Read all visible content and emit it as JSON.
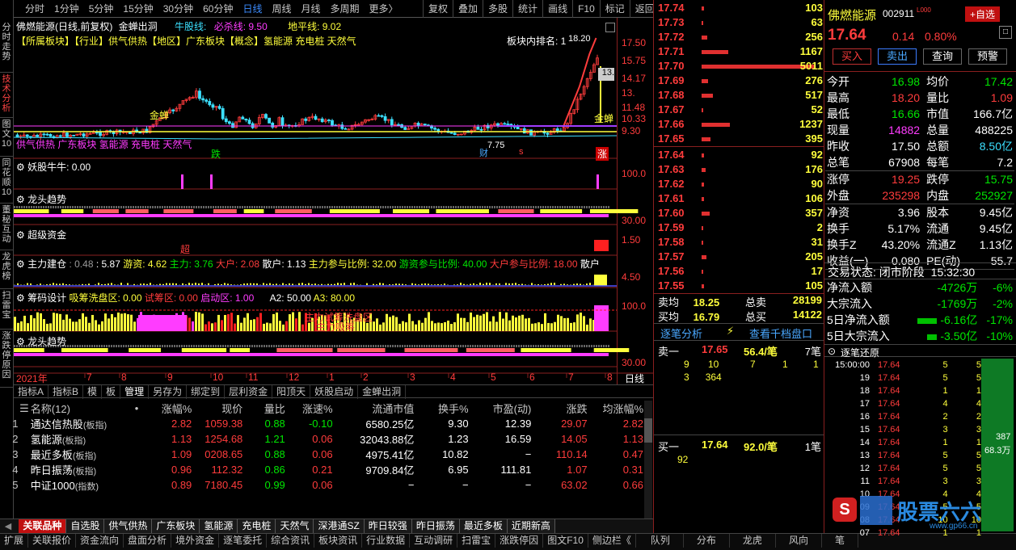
{
  "vtabs": [
    "分时走势",
    "技术分析",
    "图文10",
    "同花顺10",
    "董秘互动",
    "龙虎榜",
    "扫雷宝",
    "涨跌停原因"
  ],
  "toolbar": {
    "periods": [
      "分时",
      "1分钟",
      "5分钟",
      "15分钟",
      "30分钟",
      "60分钟",
      "日线",
      "周线",
      "月线",
      "多周期",
      "更多〉"
    ],
    "active": "日线",
    "right": [
      "复权",
      "叠加",
      "多股",
      "统计",
      "画线",
      "F10",
      "标记",
      "返回"
    ]
  },
  "main": {
    "title": "佛燃能源(日线,前复权)",
    "indicator": "金蝉出洞",
    "nl_label": "牛股线:",
    "bs_label": "必杀线: 9.50",
    "dp_label": "地平线: 9.02",
    "tags": "【所属板块】【行业】供气供热【地区】广东板块【概念】氢能源 充电桩 天然气",
    "rank_label": "板块内排名:  1",
    "peak": "18.20",
    "ticks": [
      "17.50",
      "15.75",
      "14.17",
      "13.",
      "11.48",
      "10.33",
      "9.30"
    ],
    "overlay": "供气供热 广东板块 氢能源 充电桩 天然气",
    "marks": {
      "jinchan1": "金蝉",
      "jinchan2": "金蝉",
      "die": "跌",
      "cai": "财",
      "low": "7.75",
      "s": "s",
      "zhang": "涨"
    }
  },
  "panels": [
    {
      "name": "妖股牛牛",
      "text": "妖股牛牛: 0.00",
      "tick": "100.0"
    },
    {
      "name": "龙头趋势",
      "text": "龙头趋势",
      "tick": "30.00"
    },
    {
      "name": "超级资金",
      "text": "超级资金",
      "tick": "1.50",
      "mark": "超"
    },
    {
      "name": "主力建仓",
      "values": [
        {
          "t": "主力建仓",
          "c": "wht"
        },
        {
          "t": ": 0.48",
          "c": "gry"
        },
        {
          "t": ": 5.87",
          "c": "wht"
        },
        {
          "t": "游资: 4.62",
          "c": "yel"
        },
        {
          "t": "主力: 3.76",
          "c": "grn"
        },
        {
          "t": "大户: 2.08",
          "c": "red"
        },
        {
          "t": "散户: 1.13",
          "c": "wht"
        },
        {
          "t": "主力参与比例: 32.00",
          "c": "yel"
        },
        {
          "t": "游资参与比例: 40.00",
          "c": "grn"
        },
        {
          "t": "大户参与比例: 18.00",
          "c": "red"
        },
        {
          "t": "散户",
          "c": "wht"
        }
      ],
      "tick": "4.50"
    },
    {
      "name": "筹码设计",
      "values": [
        {
          "t": "筹码设计",
          "c": "wht"
        },
        {
          "t": "吸筹洗盘区: 0.00",
          "c": "yel"
        },
        {
          "t": "试筹区: 0.00",
          "c": "red"
        },
        {
          "t": "启动区: 1.00",
          "c": "mag"
        },
        {
          "t": "A2: 50.00",
          "c": "wht"
        },
        {
          "t": "A3: 80.00",
          "c": "yel"
        }
      ],
      "tick": "100.0",
      "tick2": "0.0",
      "overlay1": "主力试筹洗盘区",
      "overlay2": "主力吸筹"
    },
    {
      "name": "龙头趋势2",
      "text": "龙头趋势",
      "tick": "30.00"
    }
  ],
  "xaxis": {
    "labels": [
      "2021年",
      "7",
      "8",
      "9",
      "10",
      "11",
      "12",
      "1",
      "2",
      "3",
      "4",
      "5",
      "6",
      "7",
      "8"
    ],
    "right": "日线"
  },
  "subtabs": [
    "指标A",
    "指标B",
    "模",
    "板",
    "管理",
    "另存为",
    "绑定到",
    "层利资金",
    "阳顶天",
    "妖股启动",
    "金蝉出洞"
  ],
  "blocks": {
    "headers": [
      "名称(12)",
      "•",
      "涨幅%",
      "现价",
      "量比",
      "涨速%",
      "流通市值",
      "换手%",
      "市盈(动)",
      "涨跌",
      "均涨幅%"
    ],
    "rows": [
      [
        "1",
        "通达信热股",
        "(板指)",
        "2.82",
        "1059.38",
        "0.88",
        "-0.10",
        "6580.25亿",
        "9.30",
        "12.39",
        "29.07",
        "2.82"
      ],
      [
        "2",
        "氢能源",
        "(板指)",
        "1.13",
        "1254.68",
        "1.21",
        "0.06",
        "32043.88亿",
        "1.23",
        "16.59",
        "14.05",
        "1.13"
      ],
      [
        "3",
        "最近多板",
        "(板指)",
        "1.09",
        "0208.65",
        "0.88",
        "0.06",
        "4975.41亿",
        "10.82",
        "−",
        "110.14",
        "0.47"
      ],
      [
        "4",
        "昨日振荡",
        "(板指)",
        "0.96",
        "112.32",
        "0.86",
        "0.21",
        "9709.84亿",
        "6.95",
        "111.81",
        "1.07",
        "0.31"
      ],
      [
        "5",
        "中证1000",
        "(指数)",
        "0.89",
        "7180.45",
        "0.99",
        "0.06",
        "−",
        "−",
        "−",
        "63.02",
        "0.66"
      ]
    ]
  },
  "bottom_tabs": [
    "关联品种",
    "自选股",
    "供气供热",
    "广东板块",
    "氢能源",
    "充电桩",
    "天然气",
    "深港通SZ",
    "昨日较强",
    "昨日振荡",
    "最近多板",
    "近期新高"
  ],
  "status_bar": [
    "扩展",
    "关联报价",
    "资金流向",
    "盘面分析",
    "境外资金",
    "逐笔委托",
    "综合资讯",
    "板块资讯",
    "行业数据",
    "互动调研",
    "扫雷宝",
    "涨跌停因",
    "图文F10",
    "侧边栏《",
    "队列",
    "分布",
    "龙虎",
    "风向",
    "笔"
  ],
  "asks": [
    [
      "17.74",
      "103"
    ],
    [
      "17.73",
      "63"
    ],
    [
      "17.72",
      "256"
    ],
    [
      "17.71",
      "1167"
    ],
    [
      "17.70",
      "5011"
    ],
    [
      "17.69",
      "276"
    ],
    [
      "17.68",
      "517"
    ],
    [
      "17.67",
      "52"
    ],
    [
      "17.66",
      "1237"
    ],
    [
      "17.65",
      "395"
    ]
  ],
  "bids": [
    [
      "17.64",
      "92"
    ],
    [
      "17.63",
      "176"
    ],
    [
      "17.62",
      "90"
    ],
    [
      "17.61",
      "106"
    ],
    [
      "17.60",
      "357"
    ],
    [
      "17.59",
      "2"
    ],
    [
      "17.58",
      "31"
    ],
    [
      "17.57",
      "205"
    ],
    [
      "17.56",
      "17"
    ],
    [
      "17.55",
      "105"
    ]
  ],
  "summary": {
    "sell_avg_l": "卖均",
    "sell_avg": "18.25",
    "sell_tot_l": "总卖",
    "sell_tot": "28199",
    "buy_avg_l": "买均",
    "buy_avg": "16.79",
    "buy_tot_l": "总买",
    "buy_tot": "14122"
  },
  "orderlinks": [
    "逐笔分析",
    "查看千档盘口"
  ],
  "sell1": {
    "label": "卖一",
    "price": "17.65",
    "vol": "56.4/笔",
    "count": "7笔",
    "queue": [
      "9",
      "10",
      "7",
      "1",
      "1"
    ],
    "queue2": [
      "3",
      "364"
    ]
  },
  "buy1": {
    "label": "买一",
    "price": "17.64",
    "vol": "92.0/笔",
    "count": "1笔",
    "queue": [
      "92"
    ]
  },
  "stock": {
    "name": "佛燃能源",
    "code": "002911",
    "tag": "L000",
    "add": "+自选",
    "price": "17.64",
    "chg": "0.14",
    "pct": "0.80%",
    "buttons": [
      "买入",
      "卖出",
      "查询",
      "预警"
    ]
  },
  "kv": [
    [
      "今开",
      "16.98",
      "grn",
      "均价",
      "17.42",
      "grn"
    ],
    [
      "最高",
      "18.20",
      "red",
      "量比",
      "1.09",
      "red"
    ],
    [
      "最低",
      "16.66",
      "grn",
      "市值",
      "166.7亿",
      "wht"
    ],
    [
      "现量",
      "14882",
      "mag",
      "总量",
      "488225",
      "wht"
    ],
    [
      "昨收",
      "17.50",
      "wht",
      "总额",
      "8.50亿",
      "cyn"
    ],
    [
      "总笔",
      "67908",
      "wht",
      "每笔",
      "7.2",
      "wht"
    ],
    [
      "涨停",
      "19.25",
      "red",
      "跌停",
      "15.75",
      "grn"
    ],
    [
      "外盘",
      "235298",
      "red",
      "内盘",
      "252927",
      "grn"
    ],
    [
      "净资",
      "3.96",
      "wht",
      "股本",
      "9.45亿",
      "wht"
    ],
    [
      "换手",
      "5.17%",
      "wht",
      "流通",
      "9.45亿",
      "wht"
    ],
    [
      "换手Z",
      "43.20%",
      "wht",
      "流通Z",
      "1.13亿",
      "wht"
    ],
    [
      "收益(一)",
      "0.080",
      "wht",
      "PE(动)",
      "55.7",
      "wht"
    ]
  ],
  "trade_state": {
    "label": "交易状态: 闭市阶段",
    "time": "15:32:30"
  },
  "flows": [
    [
      "净流入额",
      "-4726万",
      "-6%"
    ],
    [
      "大宗流入",
      "-1769万",
      "-2%"
    ],
    [
      "5日净流入额",
      "-6.16亿",
      "-17%"
    ],
    [
      "5日大宗流入",
      "-3.50亿",
      "-10%"
    ]
  ],
  "ticks_title": "逐笔还原",
  "tick_rows": [
    [
      "15:00:00",
      "17.64",
      "5",
      "5"
    ],
    [
      "19",
      "17.64",
      "5",
      "5"
    ],
    [
      "18",
      "17.64",
      "1",
      "1"
    ],
    [
      "17",
      "17.64",
      "4",
      "4"
    ],
    [
      "16",
      "17.64",
      "2",
      "2"
    ],
    [
      "15",
      "17.64",
      "3",
      "3"
    ],
    [
      "14",
      "17.64",
      "1",
      "1"
    ],
    [
      "13",
      "17.64",
      "5",
      "5"
    ],
    [
      "12",
      "17.64",
      "5",
      "5"
    ],
    [
      "11",
      "17.64",
      "3",
      "3"
    ],
    [
      "10",
      "17.64",
      "4",
      "4"
    ],
    [
      "09",
      "17.64",
      "5",
      "5"
    ],
    [
      "08",
      "17.64",
      "10",
      "10"
    ],
    [
      "07",
      "17.64",
      "1",
      "1"
    ]
  ],
  "tick_side": {
    "v1": "387",
    "v2": "68.3万"
  },
  "watermark": {
    "t1": "股票六六",
    "t2": "www.gp66.cn"
  },
  "colors": {
    "up": "#ff3c3c",
    "down": "#00e600",
    "bg": "#000000",
    "grid": "#8a1f1f"
  }
}
